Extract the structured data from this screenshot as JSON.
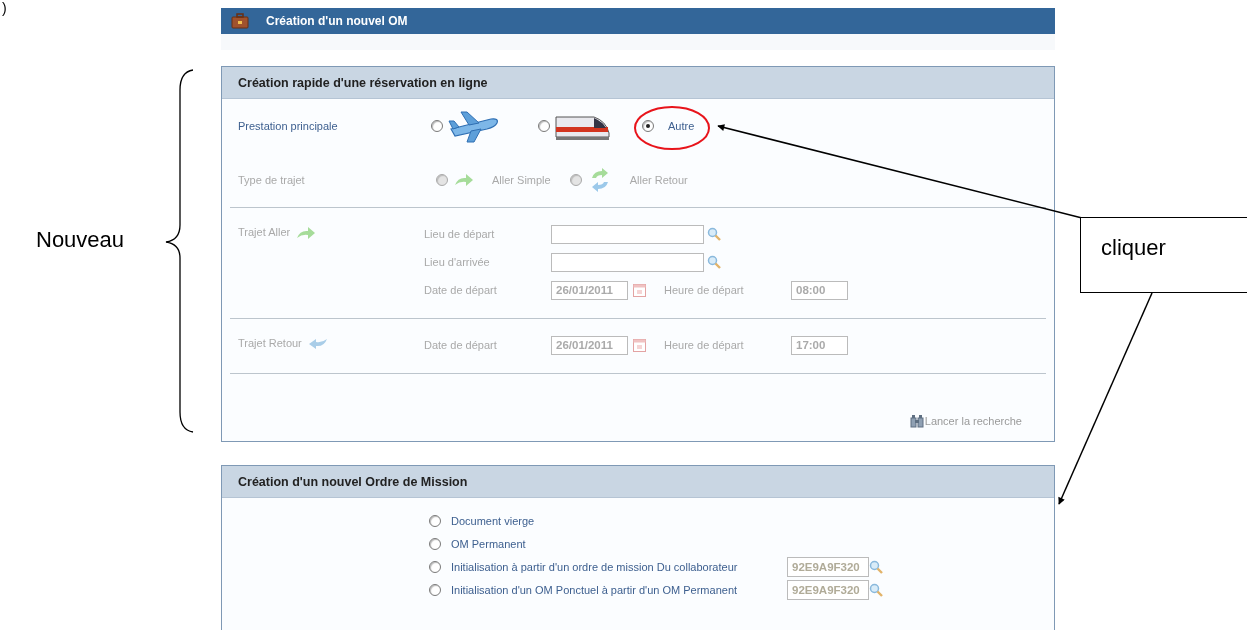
{
  "annotations": {
    "fragment": ")",
    "brace_label": "Nouveau",
    "callout": "cliquer"
  },
  "header": {
    "title": "Création d'un nouvel OM"
  },
  "quick_booking": {
    "title": "Création rapide d'une réservation en ligne",
    "main_service": {
      "label": "Prestation principale",
      "options": [
        {
          "kind": "plane",
          "selected": false
        },
        {
          "kind": "train",
          "selected": false
        },
        {
          "kind": "text",
          "label": "Autre",
          "selected": true
        }
      ]
    },
    "trip_type": {
      "label": "Type de trajet",
      "disabled": true,
      "options": [
        {
          "kind": "one-way",
          "label": "Aller Simple",
          "selected": false
        },
        {
          "kind": "return",
          "label": "Aller Retour",
          "selected": false
        }
      ]
    },
    "legs": [
      {
        "kind": "outbound",
        "label": "Trajet Aller",
        "disabled": true,
        "rows": [
          {
            "kind": "place",
            "label": "Lieu de départ"
          },
          {
            "kind": "place",
            "label": "Lieu d'arrivée"
          },
          {
            "kind": "datetime",
            "date_label": "Date de départ",
            "date": "26/01/2011",
            "time_label": "Heure de départ",
            "time": "08:00"
          }
        ]
      },
      {
        "kind": "return",
        "label": "Trajet Retour",
        "disabled": true,
        "rows": [
          {
            "kind": "datetime",
            "date_label": "Date de départ",
            "date": "26/01/2011",
            "time_label": "Heure de départ",
            "time": "17:00"
          }
        ]
      }
    ],
    "search_link": {
      "label": "Lancer la recherche",
      "disabled": true
    }
  },
  "mission": {
    "title": "Création d'un nouvel Ordre de Mission",
    "options": [
      {
        "label": "Document vierge",
        "selected": false
      },
      {
        "label": "OM Permanent",
        "selected": false
      },
      {
        "label": "Initialisation à partir d'un ordre de mission Du collaborateur",
        "selected": false,
        "value": "92E9A9F320"
      },
      {
        "label": "Initialisation d'un OM Ponctuel à partir d'un OM Permanent",
        "selected": false,
        "value": "92E9A9F320"
      }
    ]
  }
}
